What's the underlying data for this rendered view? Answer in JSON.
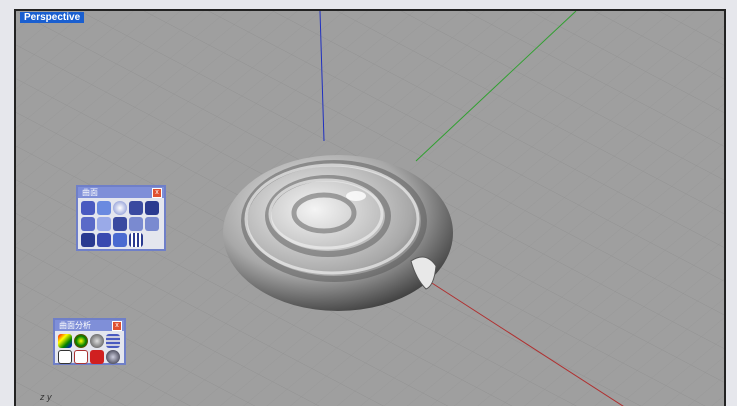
{
  "viewport": {
    "title": "Perspective",
    "axis_label": "z y"
  },
  "toolbars": [
    {
      "title": "曲面",
      "close": "x"
    },
    {
      "title": "曲面分析",
      "close": "x"
    }
  ],
  "colors": {
    "x_axis": "#b03030",
    "y_axis": "#30a030",
    "z_axis": "#2030c0",
    "title_bg": "#1a5fd0"
  }
}
